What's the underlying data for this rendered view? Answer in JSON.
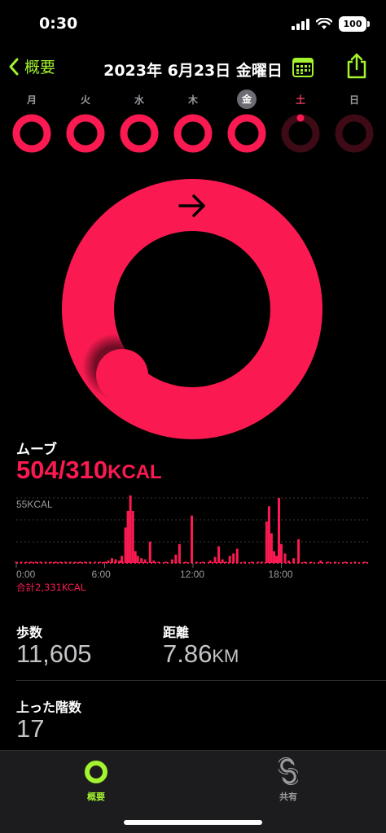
{
  "status_bar": {
    "time": "0:30",
    "battery": "100"
  },
  "nav": {
    "back_label": "概要",
    "title": "2023年 6月23日 金曜日"
  },
  "week": [
    {
      "label": "月",
      "move_ratio": 1.0
    },
    {
      "label": "火",
      "move_ratio": 1.0
    },
    {
      "label": "水",
      "move_ratio": 1.0
    },
    {
      "label": "木",
      "move_ratio": 1.0
    },
    {
      "label": "金",
      "move_ratio": 1.0,
      "selected": true
    },
    {
      "label": "土",
      "move_ratio": 0.0,
      "is_today_red": true
    },
    {
      "label": "日",
      "move_ratio": 0.0
    }
  ],
  "move": {
    "label": "ムーブ",
    "value": "504/310",
    "unit": "KCAL",
    "progress_ratio": 1.63,
    "ring_color": "#fa1a51"
  },
  "chart_data": {
    "type": "bar",
    "title": "",
    "ylabel": "55KCAL",
    "xlabel": "",
    "x_ticks": [
      "0:00",
      "6:00",
      "12:00",
      "18:00"
    ],
    "total_label": "合計2,331KCAL",
    "ylim": [
      0,
      55
    ],
    "x_range_minutes": [
      0,
      1440
    ],
    "bars": [
      {
        "minute": 0,
        "value": 1
      },
      {
        "minute": 20,
        "value": 1
      },
      {
        "minute": 40,
        "value": 1
      },
      {
        "minute": 60,
        "value": 1
      },
      {
        "minute": 80,
        "value": 1
      },
      {
        "minute": 100,
        "value": 1
      },
      {
        "minute": 120,
        "value": 1
      },
      {
        "minute": 140,
        "value": 1
      },
      {
        "minute": 160,
        "value": 1
      },
      {
        "minute": 180,
        "value": 1
      },
      {
        "minute": 200,
        "value": 1
      },
      {
        "minute": 220,
        "value": 1
      },
      {
        "minute": 240,
        "value": 1
      },
      {
        "minute": 260,
        "value": 1
      },
      {
        "minute": 280,
        "value": 1
      },
      {
        "minute": 300,
        "value": 1
      },
      {
        "minute": 320,
        "value": 1
      },
      {
        "minute": 340,
        "value": 1
      },
      {
        "minute": 360,
        "value": 1
      },
      {
        "minute": 375,
        "value": 2
      },
      {
        "minute": 390,
        "value": 4
      },
      {
        "minute": 405,
        "value": 3
      },
      {
        "minute": 420,
        "value": 2
      },
      {
        "minute": 430,
        "value": 6
      },
      {
        "minute": 445,
        "value": 30
      },
      {
        "minute": 455,
        "value": 44
      },
      {
        "minute": 465,
        "value": 57
      },
      {
        "minute": 475,
        "value": 44
      },
      {
        "minute": 485,
        "value": 10
      },
      {
        "minute": 495,
        "value": 6
      },
      {
        "minute": 510,
        "value": 4
      },
      {
        "minute": 525,
        "value": 3
      },
      {
        "minute": 545,
        "value": 18
      },
      {
        "minute": 560,
        "value": 2
      },
      {
        "minute": 580,
        "value": 1
      },
      {
        "minute": 610,
        "value": 1
      },
      {
        "minute": 635,
        "value": 3
      },
      {
        "minute": 650,
        "value": 7
      },
      {
        "minute": 665,
        "value": 16
      },
      {
        "minute": 690,
        "value": 1
      },
      {
        "minute": 715,
        "value": 40
      },
      {
        "minute": 735,
        "value": 1
      },
      {
        "minute": 760,
        "value": 1
      },
      {
        "minute": 790,
        "value": 2
      },
      {
        "minute": 810,
        "value": 5
      },
      {
        "minute": 825,
        "value": 14
      },
      {
        "minute": 840,
        "value": 3
      },
      {
        "minute": 855,
        "value": 1
      },
      {
        "minute": 870,
        "value": 6
      },
      {
        "minute": 885,
        "value": 8
      },
      {
        "minute": 900,
        "value": 12
      },
      {
        "minute": 930,
        "value": 1
      },
      {
        "minute": 960,
        "value": 1
      },
      {
        "minute": 985,
        "value": 1
      },
      {
        "minute": 1000,
        "value": 1
      },
      {
        "minute": 1020,
        "value": 35
      },
      {
        "minute": 1030,
        "value": 48
      },
      {
        "minute": 1040,
        "value": 25
      },
      {
        "minute": 1050,
        "value": 10
      },
      {
        "minute": 1060,
        "value": 6
      },
      {
        "minute": 1070,
        "value": 55
      },
      {
        "minute": 1080,
        "value": 16
      },
      {
        "minute": 1095,
        "value": 8
      },
      {
        "minute": 1110,
        "value": 2
      },
      {
        "minute": 1130,
        "value": 4
      },
      {
        "minute": 1150,
        "value": 20
      },
      {
        "minute": 1175,
        "value": 1
      },
      {
        "minute": 1200,
        "value": 1
      },
      {
        "minute": 1240,
        "value": 2
      },
      {
        "minute": 1270,
        "value": 1
      },
      {
        "minute": 1300,
        "value": 1
      },
      {
        "minute": 1340,
        "value": 1
      },
      {
        "minute": 1380,
        "value": 1
      },
      {
        "minute": 1420,
        "value": 1
      }
    ],
    "bar_color": "#fa1a51",
    "grid": true
  },
  "stats": {
    "steps_label": "歩数",
    "steps_value": "11,605",
    "distance_label": "距離",
    "distance_value": "7.86",
    "distance_unit": "KM",
    "floors_label": "上った階数",
    "floors_value": "17"
  },
  "tab_bar": {
    "summary_label": "概要",
    "sharing_label": "共有",
    "active_color": "#a3f32e"
  }
}
